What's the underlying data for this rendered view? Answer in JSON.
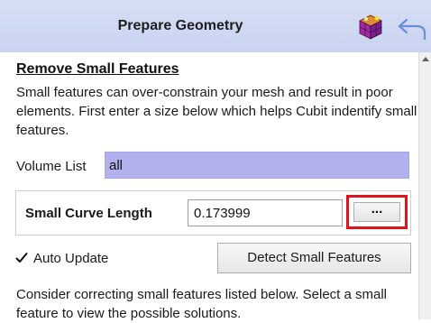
{
  "header": {
    "title": "Prepare Geometry",
    "cube_icon": "colored-cube-icon",
    "back_icon": "back-arrow-icon"
  },
  "section": {
    "title": "Remove Small Features",
    "description": "Small features can over-constrain your mesh and result in poor elements. First enter a size below which helps Cubit indentify small features."
  },
  "volume_list": {
    "label": "Volume List",
    "value": "all"
  },
  "small_curve": {
    "label": "Small Curve Length",
    "value": "0.173999",
    "button_label": "..."
  },
  "auto_update": {
    "label": "Auto Update",
    "checked": true
  },
  "detect_button": {
    "label": "Detect Small Features"
  },
  "instructions": "Consider correcting small features listed below. Select a small feature to view the possible solutions.",
  "colors": {
    "header_bg": "#ccd5f1",
    "volume_input_bg": "#b3b0ee",
    "highlight_border": "#e0151b",
    "back_arrow": "#6b8fd6"
  }
}
